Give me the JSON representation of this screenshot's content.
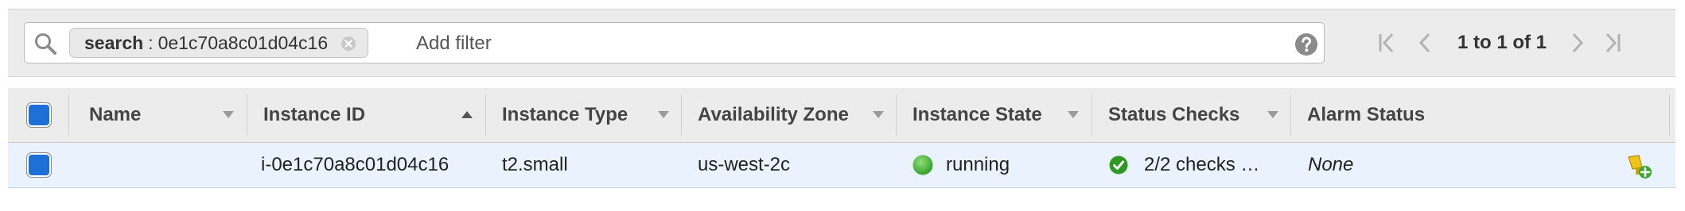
{
  "filter": {
    "token_key": "search",
    "token_separator": ":",
    "token_value": "0e1c70a8c01d04c16",
    "add_filter_placeholder": "Add filter"
  },
  "pager": {
    "text": "1 to 1 of 1"
  },
  "table": {
    "columns": [
      "Name",
      "Instance ID",
      "Instance Type",
      "Availability Zone",
      "Instance State",
      "Status Checks",
      "Alarm Status"
    ],
    "rows": [
      {
        "name": "",
        "instance_id": "i-0e1c70a8c01d04c16",
        "instance_type": "t2.small",
        "availability_zone": "us-west-2c",
        "instance_state": "running",
        "status_checks": "2/2 checks …",
        "alarm_status": "None"
      }
    ]
  },
  "colors": {
    "selected_row_bg": "#eaf2fd",
    "checkbox_blue": "#1f6fd8",
    "running_green": "#3aa82f",
    "header_bg": "#ececec"
  },
  "icons": [
    "search-icon",
    "clear-icon",
    "help-icon",
    "first-page-icon",
    "previous-page-icon",
    "next-page-icon",
    "last-page-icon",
    "sort-down-icon",
    "sort-up-icon",
    "running-status-icon",
    "check-ok-icon",
    "add-alarm-icon"
  ]
}
